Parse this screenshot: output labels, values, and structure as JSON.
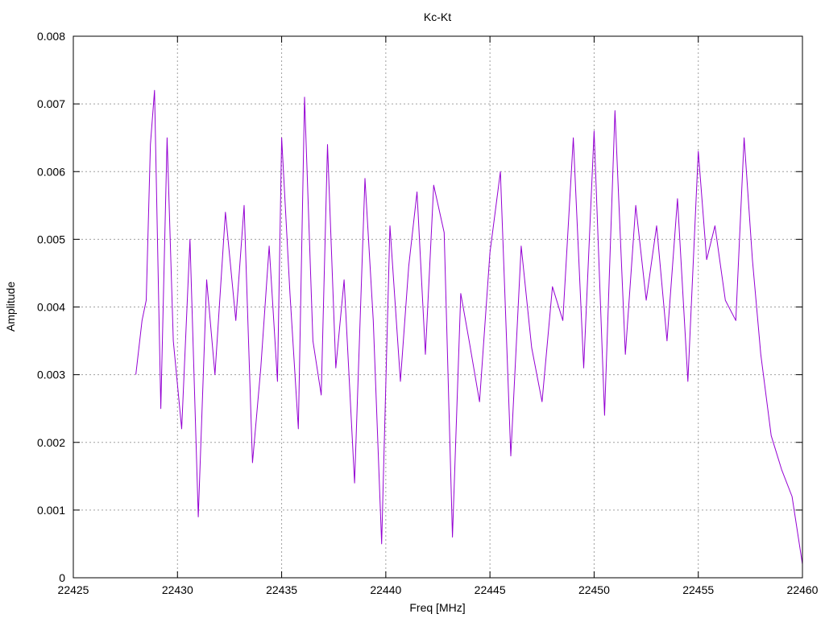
{
  "chart_data": {
    "type": "line",
    "title": "Kc-Kt",
    "xlabel": "Freq [MHz]",
    "ylabel": "Amplitude",
    "xlim": [
      22425,
      22460
    ],
    "ylim": [
      0,
      0.008
    ],
    "grid": true,
    "legend": "none",
    "x_ticks": [
      "22425",
      "22430",
      "22435",
      "22440",
      "22445",
      "22450",
      "22455",
      "22460"
    ],
    "y_ticks": [
      "0",
      "0.001",
      "0.002",
      "0.003",
      "0.004",
      "0.005",
      "0.006",
      "0.007",
      "0.008"
    ],
    "series": [
      {
        "color": "#9400d3",
        "x": [
          22428.0,
          22428.3,
          22428.5,
          22428.7,
          22428.9,
          22429.2,
          22429.5,
          22429.8,
          22430.2,
          22430.6,
          22431.0,
          22431.4,
          22431.8,
          22432.3,
          22432.8,
          22433.2,
          22433.6,
          22434.0,
          22434.4,
          22434.8,
          22435.0,
          22435.4,
          22435.8,
          22436.1,
          22436.5,
          22436.9,
          22437.2,
          22437.6,
          22438.0,
          22438.5,
          22439.0,
          22439.4,
          22439.8,
          22440.2,
          22440.7,
          22441.1,
          22441.5,
          22441.9,
          22442.3,
          22442.8,
          22443.2,
          22443.6,
          22444.0,
          22444.5,
          22445.0,
          22445.5,
          22446.0,
          22446.5,
          22447.0,
          22447.5,
          22448.0,
          22448.5,
          22449.0,
          22449.5,
          22450.0,
          22450.5,
          22451.0,
          22451.5,
          22452.0,
          22452.5,
          22453.0,
          22453.5,
          22454.0,
          22454.5,
          22455.0,
          22455.4,
          22455.8,
          22456.3,
          22456.8,
          22457.2,
          22457.6,
          22458.0,
          22458.5,
          22459.0,
          22459.5,
          22460.0
        ],
        "y": [
          0.003,
          0.0038,
          0.0041,
          0.0064,
          0.0072,
          0.0025,
          0.0065,
          0.0035,
          0.0022,
          0.005,
          0.0009,
          0.0044,
          0.003,
          0.0054,
          0.0038,
          0.0055,
          0.0017,
          0.0031,
          0.0049,
          0.0029,
          0.0065,
          0.0042,
          0.0022,
          0.0071,
          0.0035,
          0.0027,
          0.0064,
          0.0031,
          0.0044,
          0.0014,
          0.0059,
          0.0038,
          0.0005,
          0.0052,
          0.0029,
          0.0046,
          0.0057,
          0.0033,
          0.0058,
          0.0051,
          0.0006,
          0.0042,
          0.0035,
          0.0026,
          0.0048,
          0.006,
          0.0018,
          0.0049,
          0.0034,
          0.0026,
          0.0043,
          0.0038,
          0.0065,
          0.0031,
          0.0066,
          0.0024,
          0.0069,
          0.0033,
          0.0055,
          0.0041,
          0.0052,
          0.0035,
          0.0056,
          0.0029,
          0.0063,
          0.0047,
          0.0052,
          0.0041,
          0.0038,
          0.0065,
          0.0047,
          0.0033,
          0.0021,
          0.0016,
          0.0012,
          0.0002
        ]
      }
    ]
  }
}
